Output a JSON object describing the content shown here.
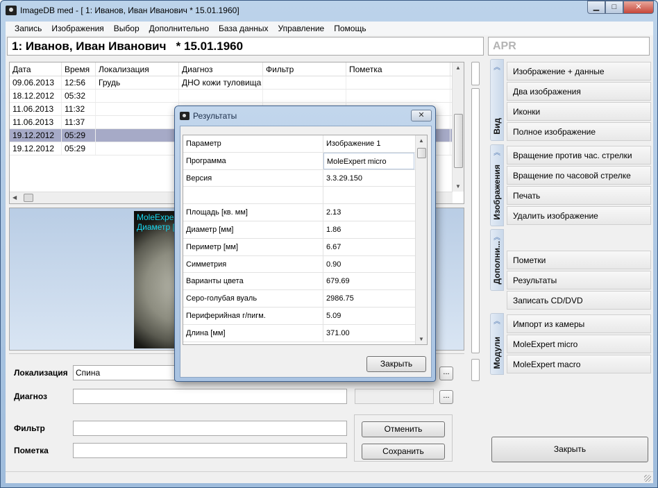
{
  "window": {
    "title": "ImageDB med - [ 1: Иванов, Иван Иванович  * 15.01.1960]",
    "minimize": "▁",
    "maximize": "□",
    "close": "✕"
  },
  "menu": [
    "Запись",
    "Изображения",
    "Выбор",
    "Дополнительно",
    "База данных",
    "Управление",
    "Помощь"
  ],
  "patient": {
    "header": "1: Иванов, Иван Иванович   * 15.01.1960",
    "code": "APR"
  },
  "table": {
    "columns": [
      "Дата",
      "Время",
      "Локализация",
      "Диагноз",
      "Фильтр",
      "Пометка"
    ],
    "rows": [
      [
        "09.06.2013",
        "12:56",
        "Грудь",
        "ДНО кожи туловища",
        "",
        ""
      ],
      [
        "18.12.2012",
        "05:32",
        "",
        "",
        "",
        ""
      ],
      [
        "11.06.2013",
        "11:32",
        "",
        "",
        "",
        ""
      ],
      [
        "11.06.2013",
        "11:37",
        "",
        "",
        "",
        ""
      ],
      [
        "19.12.2012",
        "05:29",
        "",
        "",
        "",
        ""
      ],
      [
        "19.12.2012",
        "05:29",
        "",
        "",
        "",
        ""
      ]
    ],
    "selected_row": 4
  },
  "image_overlay": {
    "line1": "MoleExpert",
    "line2": "Диаметр ["
  },
  "form": {
    "localization_label": "Локализация",
    "localization_value": "Спина",
    "diagnosis_label": "Диагноз",
    "diagnosis_value": "",
    "filter_label": "Фильтр",
    "filter_value": "",
    "mark_label": "Пометка",
    "mark_value": "",
    "ellipsis": "...",
    "cancel": "Отменить",
    "save": "Сохранить"
  },
  "right_panel": {
    "groups": [
      {
        "label": "Вид",
        "items": [
          "Изображение + данные",
          "Два изображения",
          "Иконки",
          "Полное изображение"
        ]
      },
      {
        "label": "Изображения",
        "items": [
          "Вращение против час. стрелки",
          "Вращение по часовой стрелке",
          "Печать",
          "Удалить изображение"
        ]
      },
      {
        "label": "Дополни...",
        "items": [
          "Пометки",
          "Результаты",
          "Записать CD/DVD"
        ]
      },
      {
        "label": "Модули",
        "items": [
          "Импорт из камеры",
          "MoleExpert micro",
          "MoleExpert macro"
        ]
      }
    ],
    "close": "Закрыть"
  },
  "dialog": {
    "title": "Результаты",
    "header": [
      "Параметр",
      "Изображение 1"
    ],
    "rows": [
      [
        "Программа",
        "MoleExpert micro"
      ],
      [
        "Версия",
        "3.3.29.150"
      ],
      [
        "",
        ""
      ],
      [
        "Площадь [кв. мм]",
        "2.13"
      ],
      [
        "Диаметр [мм]",
        "1.86"
      ],
      [
        "Периметр [мм]",
        "6.67"
      ],
      [
        "Симметрия",
        "0.90"
      ],
      [
        "Варианты цвета",
        "679.69"
      ],
      [
        "Серо-голубая вуаль",
        "2986.75"
      ],
      [
        "Периферийная г/пигм.",
        "5.09"
      ],
      [
        "Длина [мм]",
        "371.00"
      ]
    ],
    "close": "Закрыть"
  }
}
